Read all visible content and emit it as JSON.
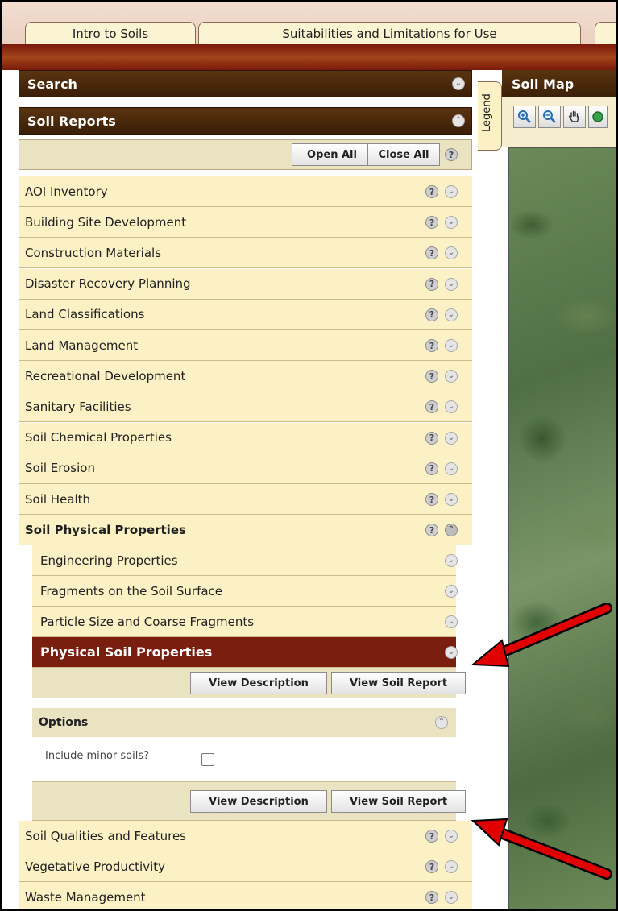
{
  "top_tabs": [
    "Intro to Soils",
    "Suitabilities and Limitations for Use"
  ],
  "search_header": "Search",
  "soil_reports_header": "Soil Reports",
  "toolbar": {
    "open_all": "Open All",
    "close_all": "Close All"
  },
  "legend_tab": "Legend",
  "map_header": "Soil Map",
  "reports_before": [
    "AOI Inventory",
    "Building Site Development",
    "Construction Materials",
    "Disaster Recovery Planning",
    "Land Classifications",
    "Land Management",
    "Recreational Development",
    "Sanitary Facilities",
    "Soil Chemical Properties",
    "Soil Erosion",
    "Soil Health"
  ],
  "expanded_category": "Soil Physical Properties",
  "sub_items": [
    "Engineering Properties",
    "Fragments on the Soil Surface",
    "Particle Size and Coarse Fragments"
  ],
  "selected_item": "Physical Soil Properties",
  "buttons": {
    "view_description": "View Description",
    "view_soil_report": "View Soil Report"
  },
  "options": {
    "title": "Options",
    "include_minor_label": "Include minor soils?",
    "include_minor_checked": false
  },
  "reports_after": [
    "Soil Qualities and Features",
    "Vegetative Productivity",
    "Waste Management"
  ],
  "icons": {
    "help": "question-circle-icon",
    "expand": "chevron-down-circle-icon",
    "collapse": "chevron-up-circle-icon",
    "zoom_in": "zoom-in-icon",
    "zoom_out": "zoom-out-icon",
    "pan": "hand-pan-icon"
  },
  "colors": {
    "header_brown": "#3b1f07",
    "selected_red": "#7a1e10",
    "row_yellow": "#fbf1c4",
    "arrow_red": "#e00000"
  }
}
